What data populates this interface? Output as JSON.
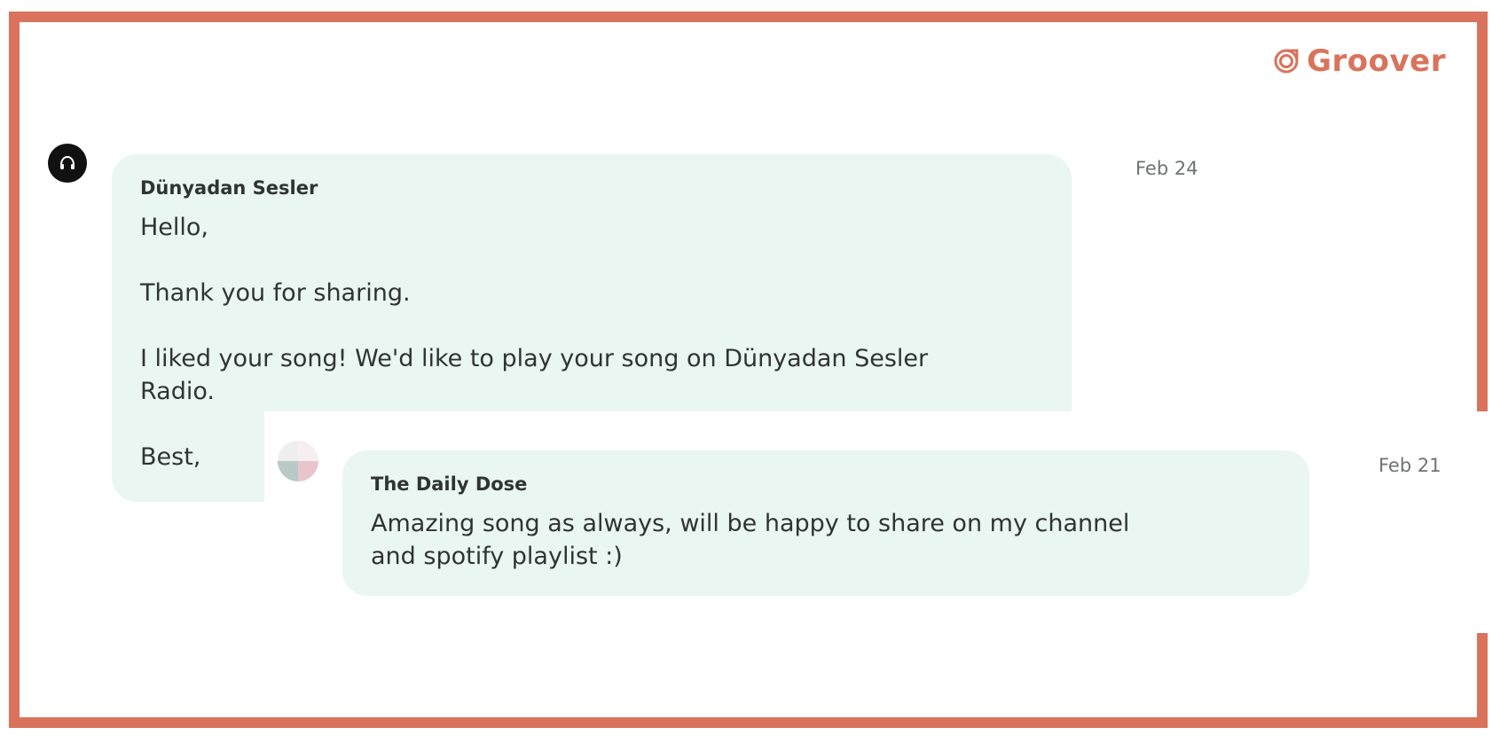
{
  "brand": {
    "name": "Groover",
    "icon": "groover-logo-icon",
    "color": "#d9735c"
  },
  "messages": [
    {
      "sender": "Dünyadan Sesler",
      "date": "Feb 24",
      "avatar_icon": "headphones-icon",
      "lines": [
        "Hello,",
        "Thank you for sharing.",
        "I liked your song! We'd like to play your song on Dünyadan Sesler",
        "Radio.",
        "Best,"
      ]
    },
    {
      "sender": "The Daily Dose",
      "date": "Feb 21",
      "avatar_icon": "quadrant-avatar-icon",
      "lines": [
        "Amazing song as always, will be happy to share on my channel",
        "and spotify playlist :)"
      ]
    }
  ],
  "colors": {
    "frame": "#d9735c",
    "bubble": "#eaf6f1",
    "text": "#2f3433",
    "date": "#6f7473"
  }
}
